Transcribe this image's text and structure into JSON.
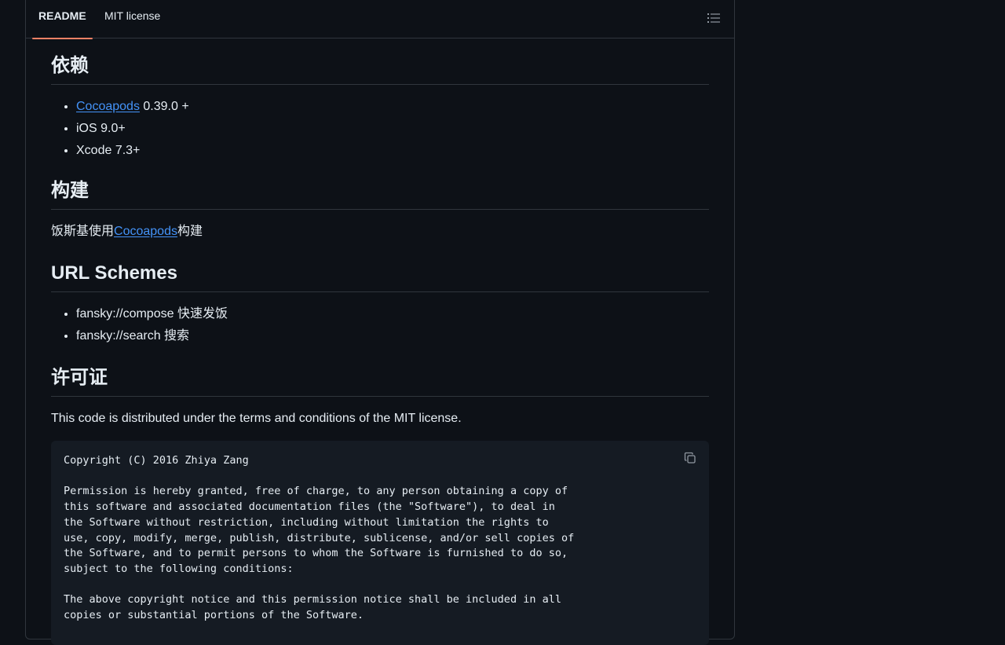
{
  "tabs": {
    "readme": "README",
    "license": "MIT license"
  },
  "sections": {
    "deps": {
      "title": "依赖",
      "items": [
        {
          "link": "Cocoapods",
          "text": " 0.39.0 +"
        },
        {
          "text": "iOS 9.0+"
        },
        {
          "text": "Xcode 7.3+"
        }
      ]
    },
    "build": {
      "title": "构建",
      "before": "饭斯基使用",
      "link": "Cocoapods",
      "after": "构建"
    },
    "schemes": {
      "title": "URL Schemes",
      "items": [
        "fansky://compose 快速发饭",
        "fansky://search 搜索"
      ]
    },
    "license": {
      "title": "许可证",
      "intro": "This code is distributed under the terms and conditions of the MIT license.",
      "code": "Copyright (C) 2016 Zhiya Zang\n\nPermission is hereby granted, free of charge, to any person obtaining a copy of\nthis software and associated documentation files (the \"Software\"), to deal in\nthe Software without restriction, including without limitation the rights to\nuse, copy, modify, merge, publish, distribute, sublicense, and/or sell copies of\nthe Software, and to permit persons to whom the Software is furnished to do so,\nsubject to the following conditions:\n\nThe above copyright notice and this permission notice shall be included in all\ncopies or substantial portions of the Software."
    }
  },
  "icons": {
    "outline": "list-unordered-icon",
    "copy": "copy-icon"
  },
  "colors": {
    "background": "#0d1117",
    "link": "#4493f8",
    "tab_underline": "#f78166",
    "code_bg": "#151b23"
  }
}
